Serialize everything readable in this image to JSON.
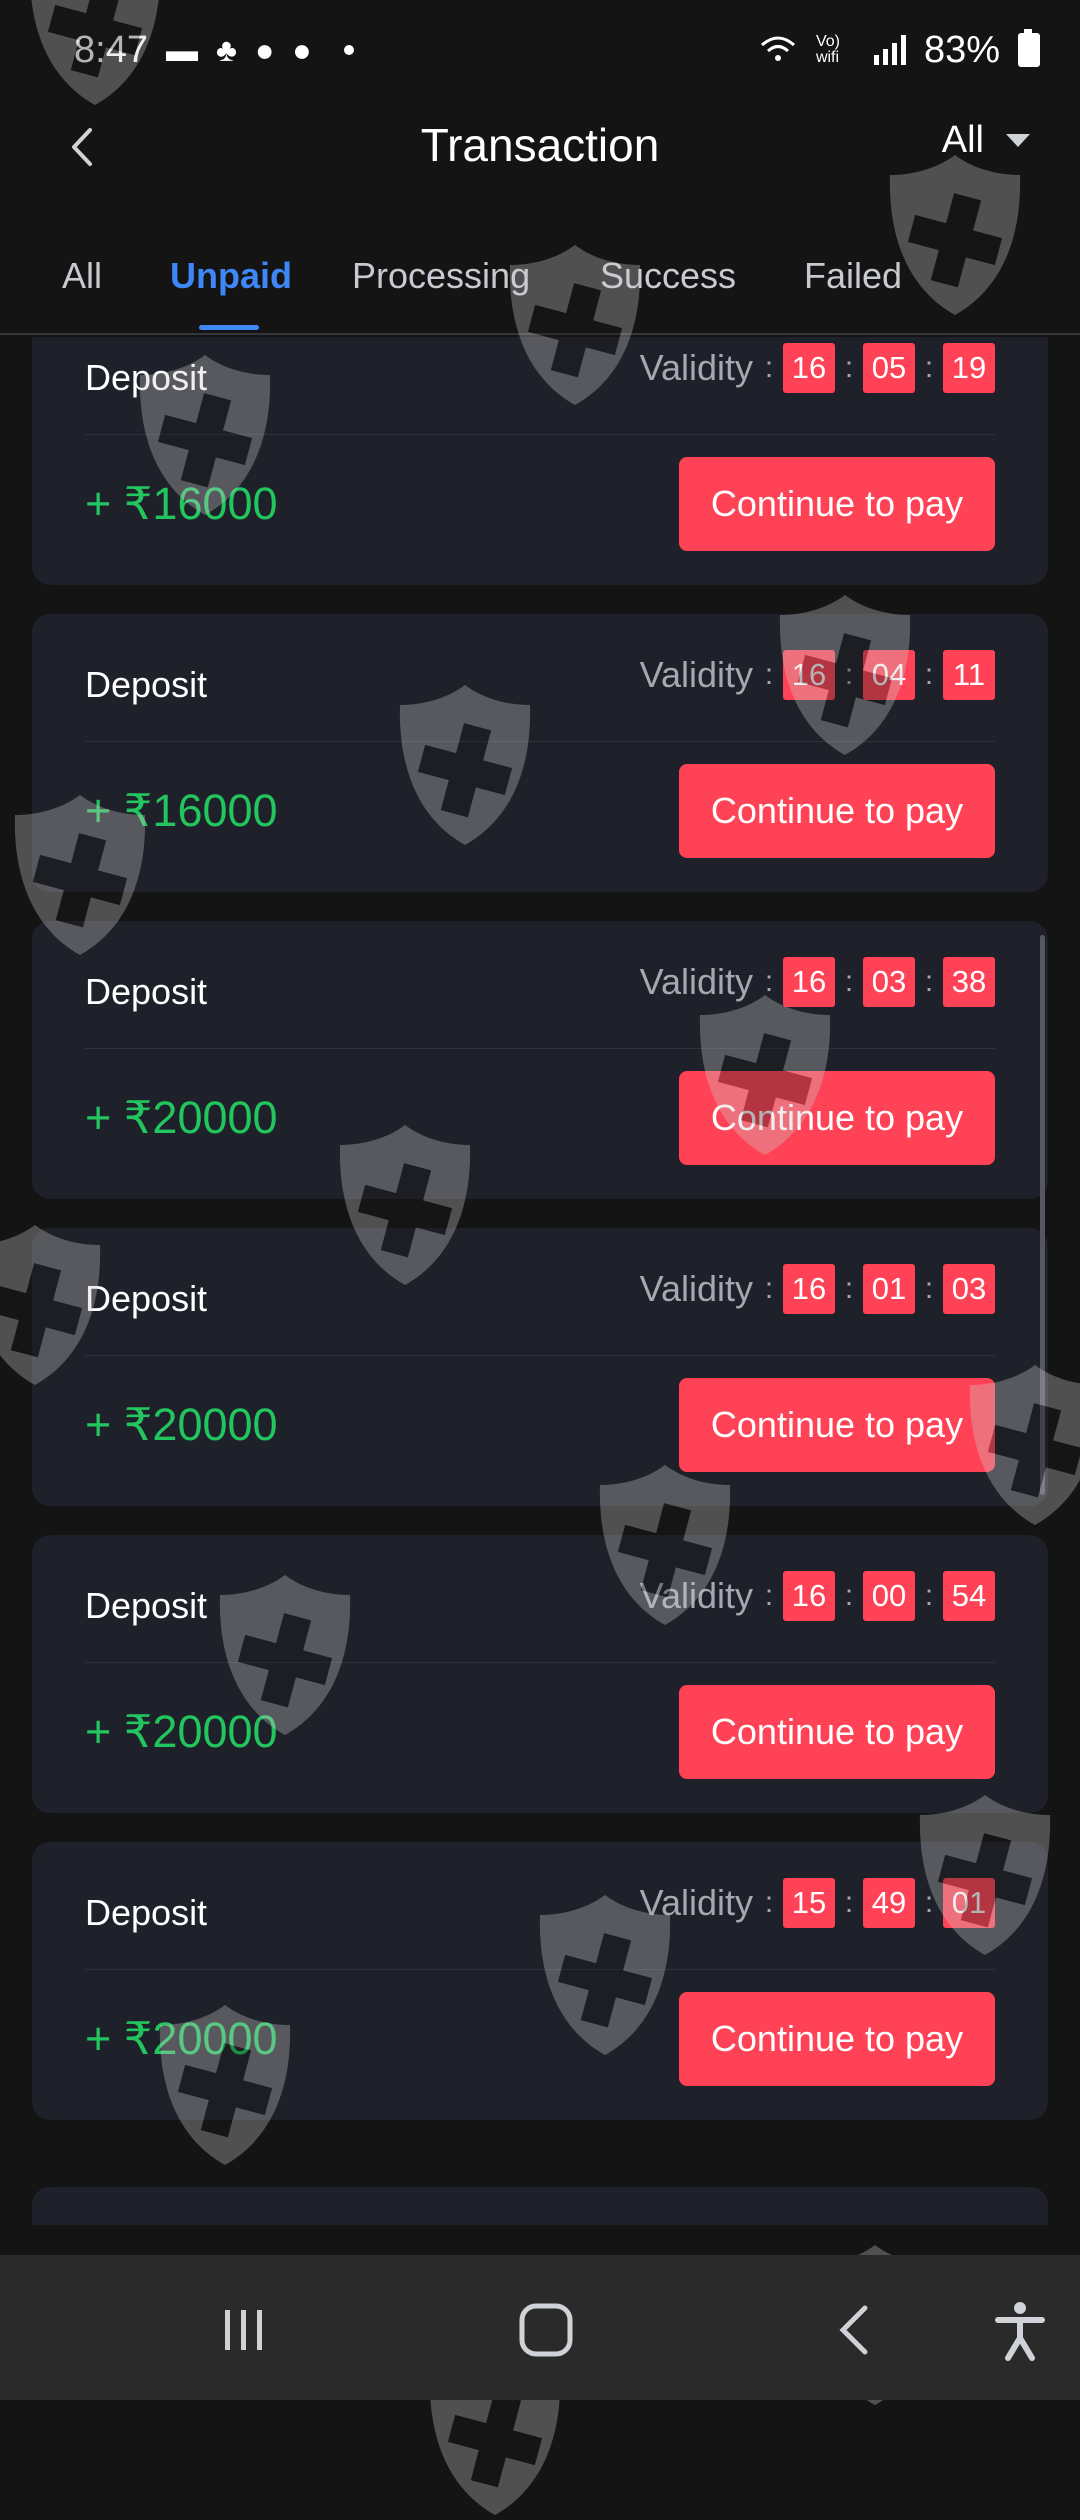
{
  "status_bar": {
    "time": "8:47",
    "network_label": "Vo) wifi",
    "battery": "83%"
  },
  "header": {
    "title": "Transaction",
    "filter_label": "All"
  },
  "tabs": [
    {
      "label": "All",
      "active": false
    },
    {
      "label": "Unpaid",
      "active": true
    },
    {
      "label": "Processing",
      "active": false
    },
    {
      "label": "Success",
      "active": false
    },
    {
      "label": "Failed",
      "active": false
    }
  ],
  "validity_label": "Validity",
  "transactions": [
    {
      "type": "Deposit",
      "amount": "+ ₹16000",
      "validity": [
        "16",
        "05",
        "19"
      ],
      "action": "Continue to pay"
    },
    {
      "type": "Deposit",
      "amount": "+ ₹16000",
      "validity": [
        "16",
        "04",
        "11"
      ],
      "action": "Continue to pay"
    },
    {
      "type": "Deposit",
      "amount": "+ ₹20000",
      "validity": [
        "16",
        "03",
        "38"
      ],
      "action": "Continue to pay"
    },
    {
      "type": "Deposit",
      "amount": "+ ₹20000",
      "validity": [
        "16",
        "01",
        "03"
      ],
      "action": "Continue to pay"
    },
    {
      "type": "Deposit",
      "amount": "+ ₹20000",
      "validity": [
        "16",
        "00",
        "54"
      ],
      "action": "Continue to pay"
    },
    {
      "type": "Deposit",
      "amount": "+ ₹20000",
      "validity": [
        "15",
        "49",
        "01"
      ],
      "action": "Continue to pay"
    }
  ],
  "colors": {
    "accent": "#3f86f7",
    "pay_button": "#ff4256",
    "amount": "#22c55e",
    "card": "#1e2129",
    "background": "#141414"
  },
  "icons": [
    "message-icon",
    "app-notification-icon",
    "chat-bubble-icon",
    "wifi-icon",
    "signal-icon",
    "battery-icon",
    "back-arrow-icon",
    "recent-apps-icon",
    "home-icon",
    "accessibility-icon",
    "watermark-shield-icon"
  ]
}
